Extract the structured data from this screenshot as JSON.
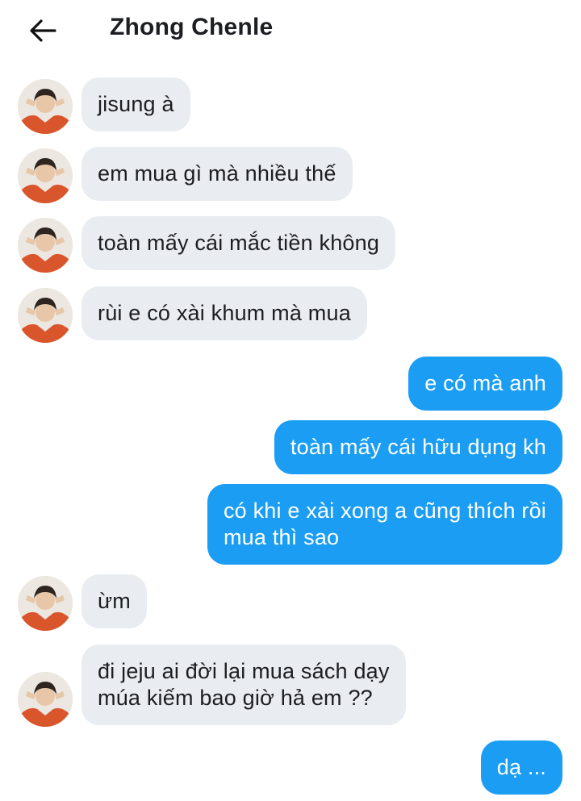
{
  "header": {
    "title": "Zhong Chenle",
    "back_icon": "arrow-left-icon"
  },
  "colors": {
    "incoming_bubble": "#e9ecf0",
    "outgoing_bubble": "#1a9df2",
    "text": "#1c1e21"
  },
  "messages": [
    {
      "direction": "incoming",
      "text": "jisung à"
    },
    {
      "direction": "incoming",
      "text": "em mua gì mà nhiều thế"
    },
    {
      "direction": "incoming",
      "text": "toàn mấy cái mắc tiền không"
    },
    {
      "direction": "incoming",
      "text": "rùi e có xài khum mà mua"
    },
    {
      "direction": "outgoing",
      "text": "e có mà anh"
    },
    {
      "direction": "outgoing",
      "text": "toàn mấy cái hữu dụng kh"
    },
    {
      "direction": "outgoing",
      "text": "có khi e xài xong a cũng thích rồi\nmua thì sao"
    },
    {
      "direction": "incoming",
      "text": "ừm"
    },
    {
      "direction": "incoming",
      "text": "đi jeju ai đời lại mua sách dạy\nmúa kiếm bao giờ hả em ??"
    },
    {
      "direction": "outgoing",
      "text": "dạ ..."
    }
  ]
}
